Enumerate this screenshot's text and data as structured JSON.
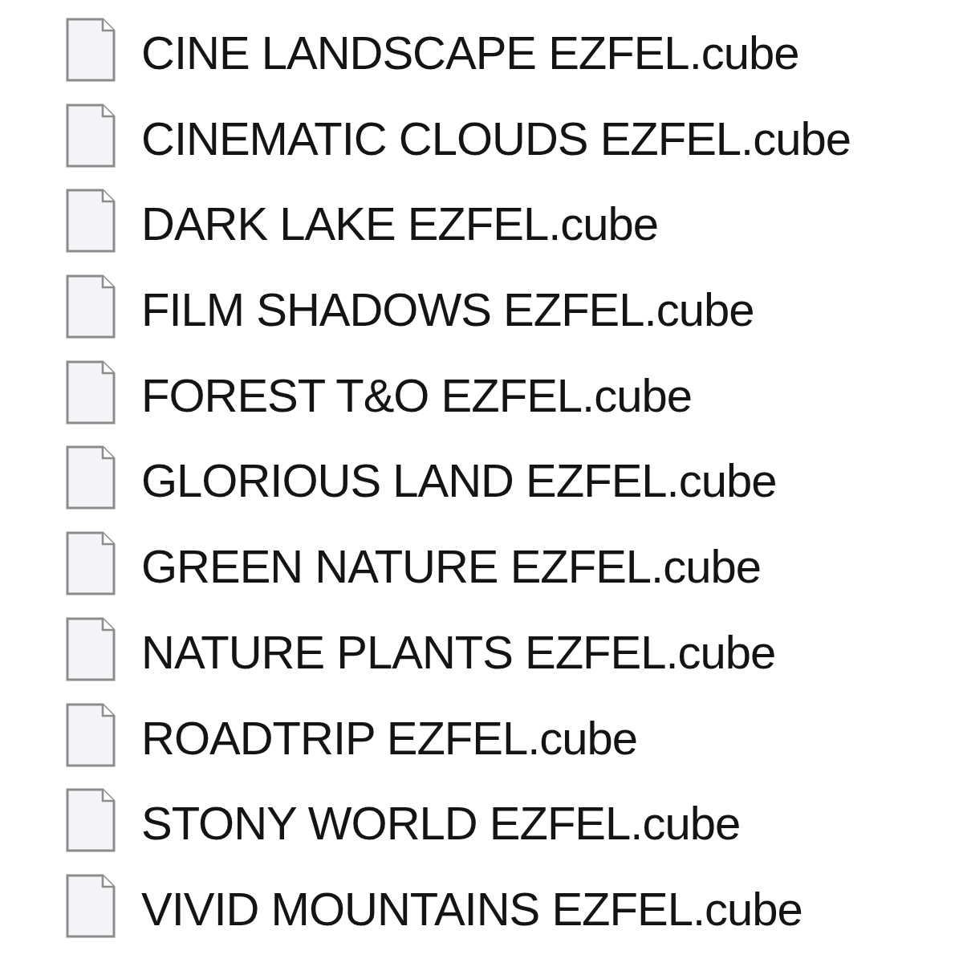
{
  "files": [
    "CINE LANDSCAPE EZFEL.cube",
    "CINEMATIC CLOUDS EZFEL.cube",
    "DARK LAKE EZFEL.cube",
    "FILM SHADOWS EZFEL.cube",
    "FOREST T&O EZFEL.cube",
    "GLORIOUS LAND EZFEL.cube",
    "GREEN NATURE EZFEL.cube",
    "NATURE PLANTS EZFEL.cube",
    "ROADTRIP EZFEL.cube",
    "STONY WORLD EZFEL.cube",
    "VIVID MOUNTAINS EZFEL.cube"
  ]
}
